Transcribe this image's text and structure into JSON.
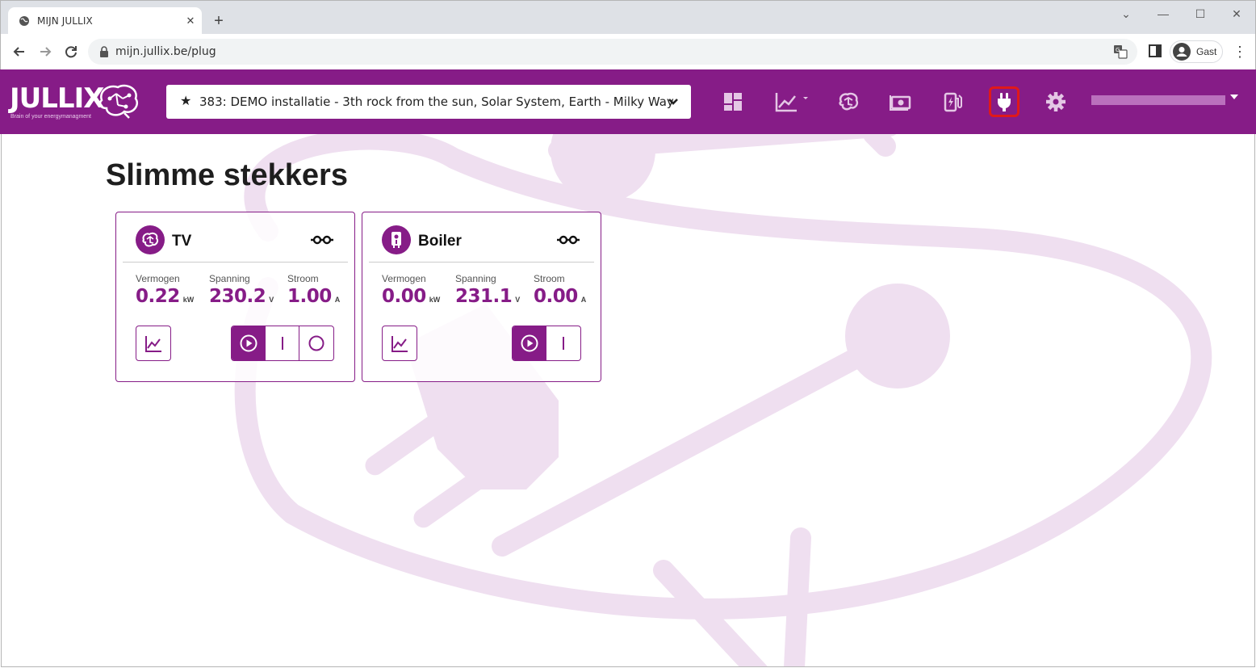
{
  "browser": {
    "tab_title": "MIJN JULLIX",
    "url": "mijn.jullix.be/plug",
    "profile_name": "Gast"
  },
  "app": {
    "logo_text": "JULLIX",
    "logo_tagline": "Brain of your energymanagment",
    "installation": "383: DEMO installatie - 3th rock from the sun, Solar System, Earth - Milky Way",
    "nav_icons": [
      "dashboard-icon",
      "chart-icon",
      "brain-icon",
      "money-icon",
      "charging-station-icon",
      "plug-icon",
      "gear-icon"
    ],
    "active_nav": "plug-icon"
  },
  "page": {
    "title": "Slimme stekkers"
  },
  "labels": {
    "power": "Vermogen",
    "voltage": "Spanning",
    "current": "Stroom"
  },
  "plugs": [
    {
      "name": "TV",
      "icon": "brain-icon",
      "power": "0.22",
      "power_unit": "kW",
      "voltage": "230.2",
      "voltage_unit": "V",
      "current": "1.00",
      "current_unit": "A",
      "modes": [
        "auto",
        "on",
        "off"
      ],
      "active_mode": "auto"
    },
    {
      "name": "Boiler",
      "icon": "boiler-icon",
      "power": "0.00",
      "power_unit": "kW",
      "voltage": "231.1",
      "voltage_unit": "V",
      "current": "0.00",
      "current_unit": "A",
      "modes": [
        "auto",
        "on"
      ],
      "active_mode": "auto"
    }
  ],
  "colors": {
    "brand": "#861c87",
    "background_watermark": "#efdff0",
    "active_highlight": "#e01919"
  }
}
